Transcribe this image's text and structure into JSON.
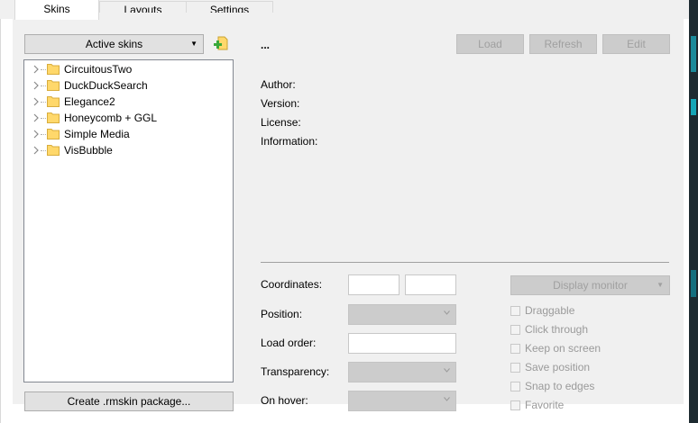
{
  "tabs": [
    {
      "label": "Skins",
      "active": true
    },
    {
      "label": "Layouts",
      "active": false
    },
    {
      "label": "Settings",
      "active": false
    }
  ],
  "skins_panel": {
    "active_skins_label": "Active skins",
    "add_icon": "add-folder-icon",
    "tree_items": [
      {
        "label": "CircuitousTwo"
      },
      {
        "label": "DuckDuckSearch"
      },
      {
        "label": "Elegance2"
      },
      {
        "label": "Honeycomb + GGL"
      },
      {
        "label": "Simple Media"
      },
      {
        "label": "VisBubble"
      }
    ],
    "create_package_label": "Create .rmskin package..."
  },
  "details": {
    "skin_name": "...",
    "load_label": "Load",
    "refresh_label": "Refresh",
    "edit_label": "Edit",
    "author_label": "Author:",
    "version_label": "Version:",
    "license_label": "License:",
    "information_label": "Information:"
  },
  "settings": {
    "coordinates_label": "Coordinates:",
    "position_label": "Position:",
    "load_order_label": "Load order:",
    "transparency_label": "Transparency:",
    "on_hover_label": "On hover:",
    "display_monitor_label": "Display monitor",
    "checkboxes": [
      {
        "label": "Draggable",
        "checked": false
      },
      {
        "label": "Click through",
        "checked": false
      },
      {
        "label": "Keep on screen",
        "checked": false
      },
      {
        "label": "Save position",
        "checked": false
      },
      {
        "label": "Snap to edges",
        "checked": false
      },
      {
        "label": "Favorite",
        "checked": false
      }
    ]
  },
  "colors": {
    "folder_yellow": "#ffd86b",
    "add_icon_green": "#3aa83a",
    "disabled_text": "#a0a0a0"
  }
}
